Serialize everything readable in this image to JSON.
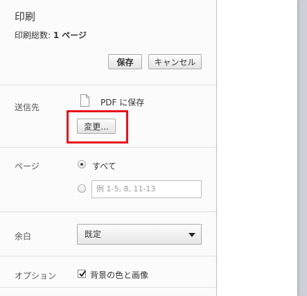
{
  "header": {
    "title": "印刷",
    "total_label": "印刷総数:",
    "total_value": "1",
    "total_unit": "ページ"
  },
  "buttons": {
    "save": "保存",
    "cancel": "キャンセル",
    "change": "変更..."
  },
  "destination": {
    "label": "送信先",
    "value": "PDF に保存",
    "icon": "pdf-document-icon"
  },
  "pages": {
    "label": "ページ",
    "all_option": "すべて",
    "selected": "all",
    "range_placeholder": "例 1-5, 8, 11-13"
  },
  "margins": {
    "label": "余白",
    "selected": "既定"
  },
  "options": {
    "label": "オプション",
    "background_label": "背景の色と画像",
    "background_checked": true
  },
  "colors": {
    "highlight": "#e8101a",
    "preview_background": "#ccd0d6"
  }
}
